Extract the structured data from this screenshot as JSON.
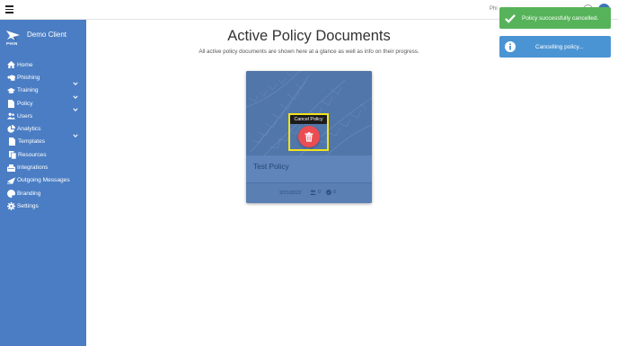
{
  "topbar": {
    "right_text": "Phi"
  },
  "brand": {
    "name": "Demo Client",
    "logo_text": "PHIN"
  },
  "sidebar": {
    "items": [
      {
        "label": "Home",
        "icon": "home-icon",
        "sub": false,
        "expandable": false
      },
      {
        "label": "Phishing",
        "icon": "fish-icon",
        "sub": false,
        "expandable": true
      },
      {
        "label": "Training",
        "icon": "graduation-cap-icon",
        "sub": false,
        "expandable": true
      },
      {
        "label": "Policy",
        "icon": "document-icon",
        "sub": false,
        "expandable": true
      },
      {
        "label": "Users",
        "icon": "users-icon",
        "sub": false,
        "expandable": false
      },
      {
        "label": "Analytics",
        "icon": "pie-chart-icon",
        "sub": false,
        "expandable": true
      },
      {
        "label": "Templates",
        "icon": "file-icon",
        "sub": true,
        "expandable": false
      },
      {
        "label": "Resources",
        "icon": "copy-icon",
        "sub": true,
        "expandable": false
      },
      {
        "label": "Integrations",
        "icon": "plug-icon",
        "sub": false,
        "expandable": false
      },
      {
        "label": "Outgoing Messages",
        "icon": "paper-plane-icon",
        "sub": false,
        "expandable": false
      },
      {
        "label": "Branding",
        "icon": "palette-icon",
        "sub": false,
        "expandable": false
      },
      {
        "label": "Settings",
        "icon": "gear-icon",
        "sub": false,
        "expandable": false
      }
    ]
  },
  "main": {
    "title": "Active Policy Documents",
    "subtitle": "All active policy documents are shown here at a glance as well as info on their progress."
  },
  "card": {
    "title": "Test Policy",
    "date": "2/21/2022",
    "users_count": "0",
    "completed_count": "0",
    "tooltip": "Cancel Policy"
  },
  "toasts": {
    "success": "Policy successfully cancelled.",
    "info": "Cancelling policy..."
  },
  "colors": {
    "sidebar": "#4a7dc4",
    "success": "#57b35a",
    "info": "#4b94d4",
    "danger": "#ea4d52",
    "highlight": "#f2e21a"
  }
}
